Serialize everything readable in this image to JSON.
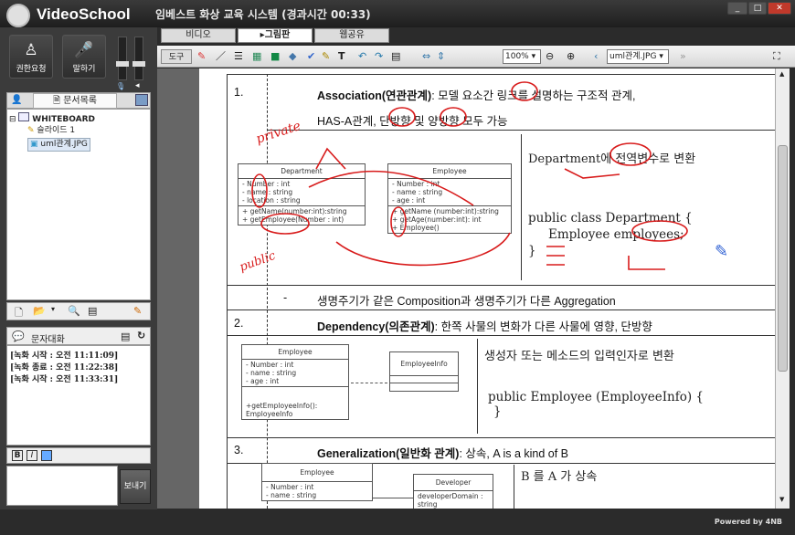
{
  "app": {
    "logo_text": "VideoSchool",
    "session_title": "임베스트 화상 교육 시스템 (경과시간 00:33)",
    "powered_by": "Powered by 4NB"
  },
  "left": {
    "request_button": "권한요청",
    "speak_button": "말하기",
    "doc_list_tab": "문서목록",
    "tree": {
      "root": "WHITEBOARD",
      "slide": "슬라이드 1",
      "file": "uml관계.JPG"
    },
    "chat": {
      "title": "문자대화",
      "lines": [
        "[녹화 시작 : 오전 11:11:09]",
        "[녹화 종료 : 오전 11:22:38]",
        "[녹화 시작 : 오전 11:33:31]"
      ],
      "send_button": "보내기"
    }
  },
  "tabs": [
    "비디오",
    "그림판",
    "웹공유"
  ],
  "toolbar": {
    "tools_label": "도구",
    "zoom": "100%",
    "file": "uml관계.JPG"
  },
  "doc": {
    "s1_num": "1.",
    "s1_title": "Association(연관관계)",
    "s1_desc": ": 모델 요소간 링크를 설명하는 구조적 관계,",
    "s1_desc2": "HAS-A관계, 단방향 및 양방향 모두 가능",
    "dept_title": "Department",
    "dept_attrs": [
      "- Number : int",
      "- name : string",
      "- location : string"
    ],
    "dept_ops": [
      "+ getName(number:int):string",
      "+ getEmployee(Number : int)"
    ],
    "emp_title": "Employee",
    "emp_attrs": [
      "- Number : int",
      "- name : string",
      "- age : int"
    ],
    "emp_ops": [
      "+ getName (number:int):string",
      "+ getAge(number:int): int",
      "+ Employee()"
    ],
    "dept_global": "Department에 전역변수로 변환",
    "code1": "public class Department {",
    "code2": "Employee employees;",
    "code3": "}",
    "dash": "-",
    "lifecycle": "생명주기가 같은 Composition과 생명주기가 다른 Aggregation",
    "s2_num": "2.",
    "s2_title": "Dependency(의존관계)",
    "s2_desc": ": 한쪽 사물의 변화가 다른 사물에 영향, 단방향",
    "e2_title": "Employee",
    "e2_attrs": [
      "- Number : int",
      "- name : string",
      "- age : int"
    ],
    "e2_ops": [
      "+getEmployeeInfo(): EmployeeInfo"
    ],
    "info_title": "EmployeeInfo",
    "ctor_desc": "생성자 또는 메소드의 입력인자로 변환",
    "code4": "public Employee (EmployeeInfo) {",
    "code5": "}",
    "s3_num": "3.",
    "s3_title": "Generalization(일반화 관계)",
    "s3_desc": ": 상속, A is a kind of B",
    "e3_title": "Employee",
    "e3_attrs": [
      "- Number : int",
      "- name : string"
    ],
    "dev_title": "Developer",
    "dev_attr": "developerDomain : string",
    "inherit": "B 를 A 가 상속"
  },
  "annotations": {
    "private": "private",
    "public": "public"
  },
  "colors": {
    "ink": "#d81b1b",
    "chrome": "#2b2b2b"
  }
}
